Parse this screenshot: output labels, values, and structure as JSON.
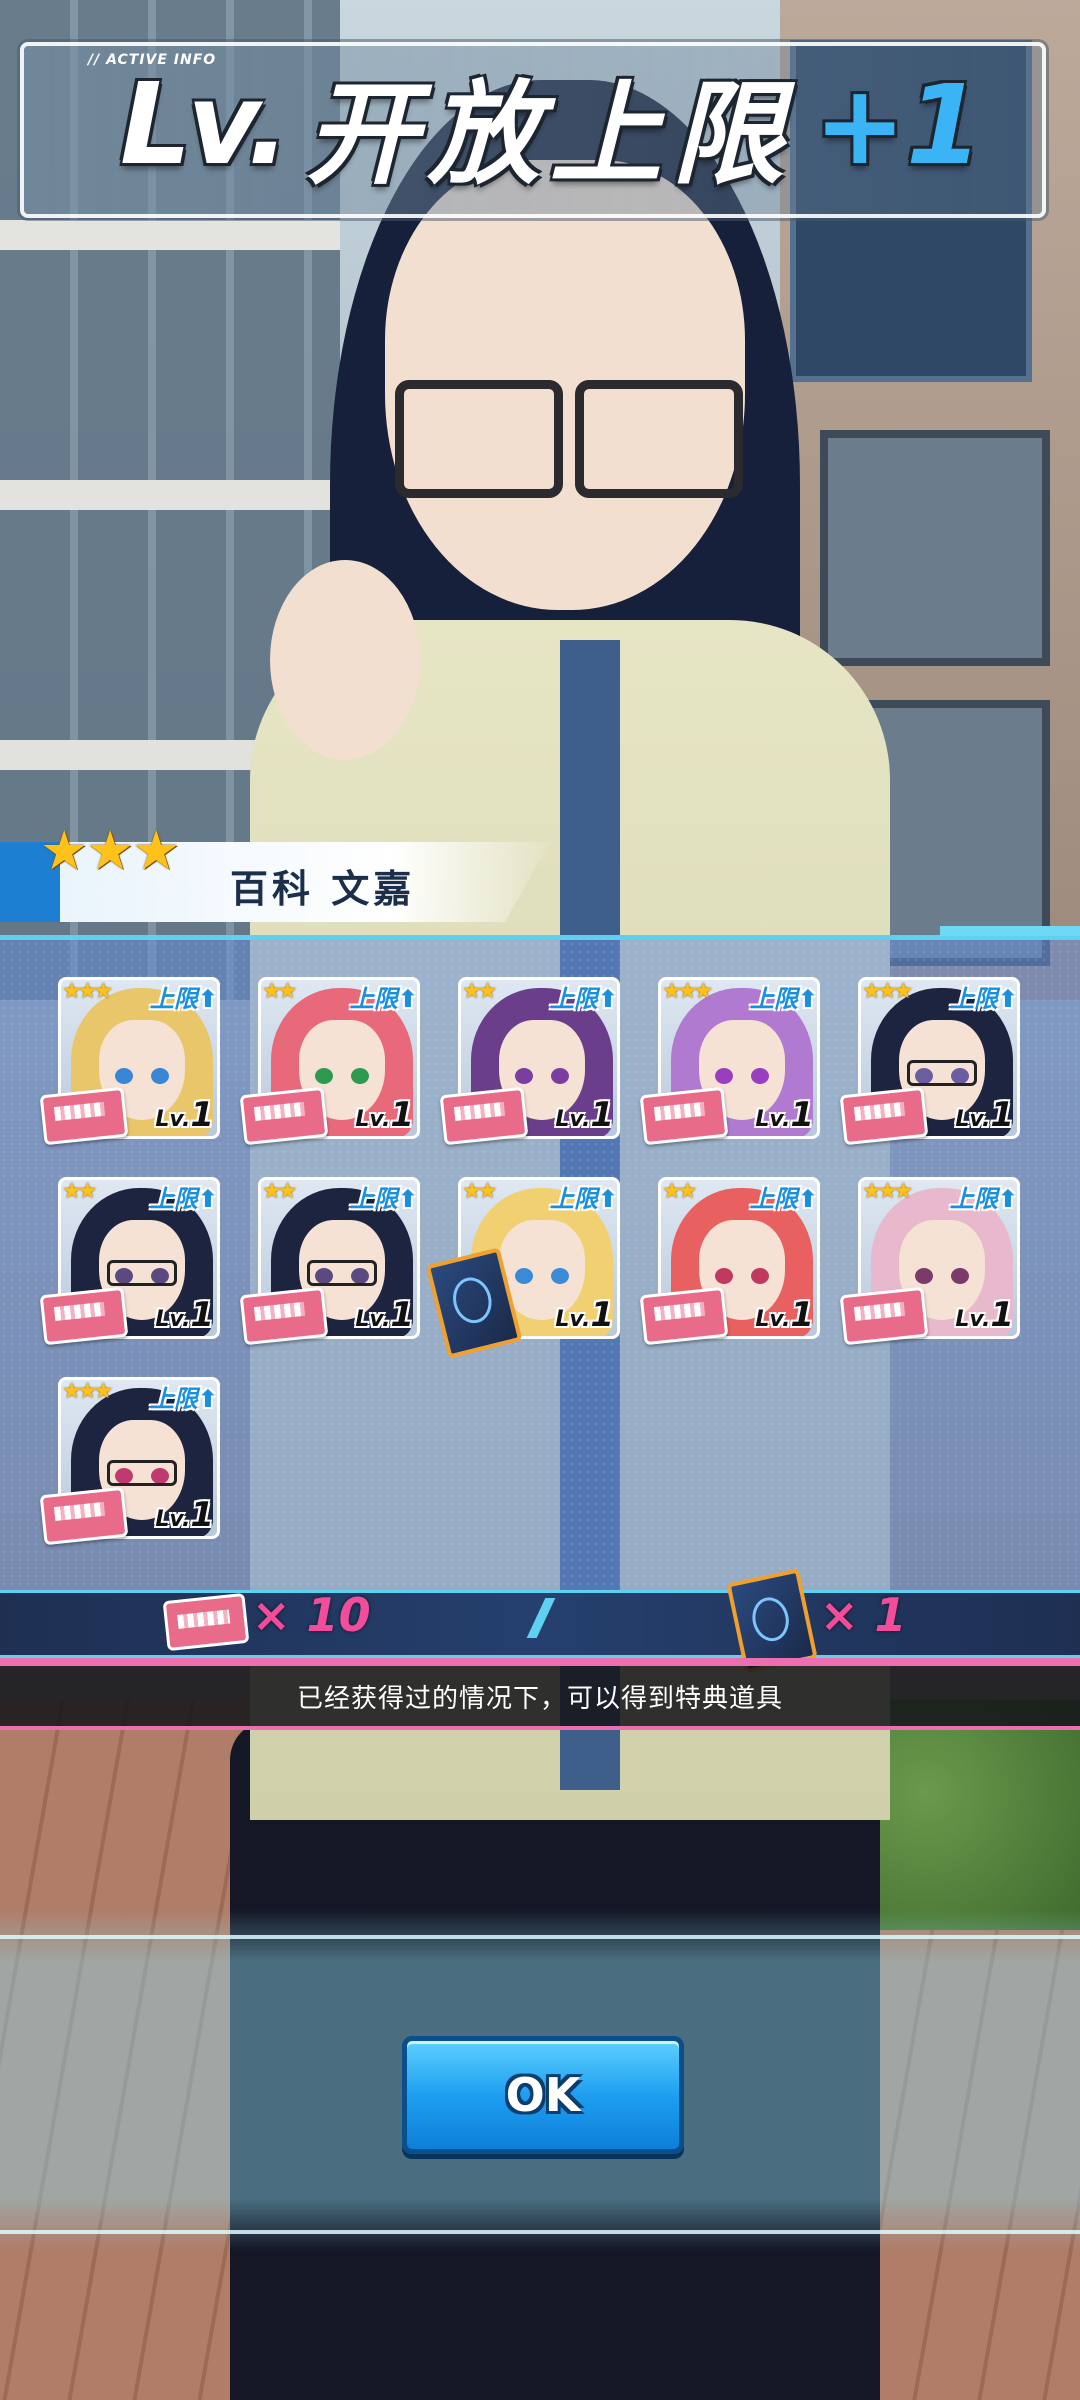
{
  "title": {
    "tag": "// ACTIVE INFO",
    "lv": "Lv.",
    "main": "开放上限",
    "plus": "+1"
  },
  "character": {
    "stars": "★★★",
    "name": "百科 文嘉"
  },
  "cards": [
    {
      "stars": "★★★",
      "cap": "上限⬆",
      "lv_prefix": "Lv.",
      "lv": "1",
      "hair": "#e9c66a",
      "eye": "#3a86d6",
      "glasses": false,
      "item": "ticket"
    },
    {
      "stars": "★★",
      "cap": "上限⬆",
      "lv_prefix": "Lv.",
      "lv": "1",
      "hair": "#e86a7a",
      "eye": "#2e9a4f",
      "glasses": false,
      "item": "ticket"
    },
    {
      "stars": "★★",
      "cap": "上限⬆",
      "lv_prefix": "Lv.",
      "lv": "1",
      "hair": "#6a3e8a",
      "eye": "#7a3ea0",
      "glasses": false,
      "item": "ticket"
    },
    {
      "stars": "★★★",
      "cap": "上限⬆",
      "lv_prefix": "Lv.",
      "lv": "1",
      "hair": "#b07ad0",
      "eye": "#9a3ec0",
      "glasses": false,
      "item": "ticket"
    },
    {
      "stars": "★★★",
      "cap": "上限⬆",
      "lv_prefix": "Lv.",
      "lv": "1",
      "hair": "#1c2440",
      "eye": "#6a5ea0",
      "glasses": true,
      "item": "ticket"
    },
    {
      "stars": "★★",
      "cap": "上限⬆",
      "lv_prefix": "Lv.",
      "lv": "1",
      "hair": "#1c2440",
      "eye": "#5a4a80",
      "glasses": true,
      "item": "ticket"
    },
    {
      "stars": "★★",
      "cap": "上限⬆",
      "lv_prefix": "Lv.",
      "lv": "1",
      "hair": "#1c2440",
      "eye": "#5a4a80",
      "glasses": true,
      "item": "ticket"
    },
    {
      "stars": "★★",
      "cap": "上限⬆",
      "lv_prefix": "Lv.",
      "lv": "1",
      "hair": "#f0d070",
      "eye": "#3a8ad6",
      "glasses": false,
      "item": "special"
    },
    {
      "stars": "★★",
      "cap": "上限⬆",
      "lv_prefix": "Lv.",
      "lv": "1",
      "hair": "#e86060",
      "eye": "#c03a60",
      "glasses": false,
      "item": "ticket"
    },
    {
      "stars": "★★★",
      "cap": "上限⬆",
      "lv_prefix": "Lv.",
      "lv": "1",
      "hair": "#e8b8cc",
      "eye": "#7a3a6a",
      "glasses": false,
      "item": "ticket"
    },
    {
      "stars": "★★★",
      "cap": "上限⬆",
      "lv_prefix": "Lv.",
      "lv": "1",
      "hair": "#1c2440",
      "eye": "#c03a70",
      "glasses": true,
      "item": "ticket"
    }
  ],
  "rewards": {
    "ticket_count": "× 10",
    "special_count": "× 1"
  },
  "info_text": "已经获得过的情况下，可以得到特典道具",
  "ok_label": "OK",
  "colors": {
    "accent_cyan": "#5fd0f0",
    "accent_pink": "#ee6fb0",
    "count_pink": "#f24d9a",
    "ok_blue": "#1e9ff0"
  }
}
